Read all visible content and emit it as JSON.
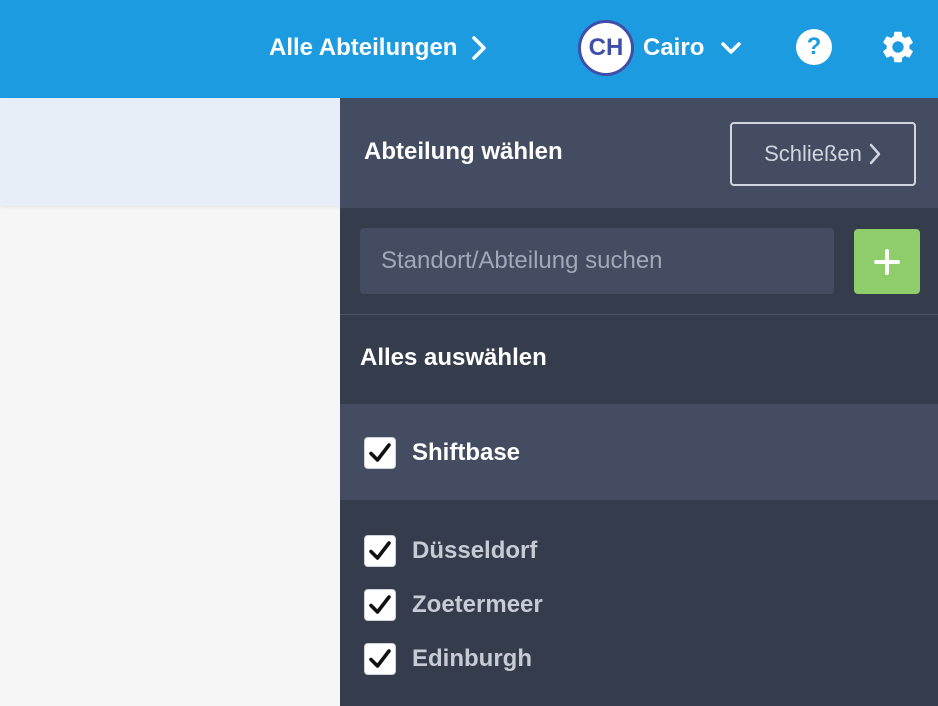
{
  "topbar": {
    "department_link": "Alle Abteilungen",
    "user": {
      "initials": "CH",
      "name": "Cairo"
    },
    "help_label": "?",
    "background": "#1d9be0",
    "icons": [
      "chevron-right-icon",
      "chevron-down-icon",
      "help-icon",
      "gear-icon"
    ]
  },
  "panel": {
    "title": "Abteilung wählen",
    "close_label": "Schließen",
    "search": {
      "placeholder": "Standort/Abteilung suchen",
      "value": ""
    },
    "add_icon": "plus-icon",
    "select_all_label": "Alles auswählen",
    "organization": {
      "label": "Shiftbase",
      "checked": true
    },
    "departments": [
      {
        "label": "Düsseldorf",
        "checked": true
      },
      {
        "label": "Zoetermeer",
        "checked": true
      },
      {
        "label": "Edinburgh",
        "checked": true
      }
    ],
    "colors": {
      "panel": "#353c4b",
      "header": "#434c60",
      "add_button": "#8fcd6b"
    }
  }
}
